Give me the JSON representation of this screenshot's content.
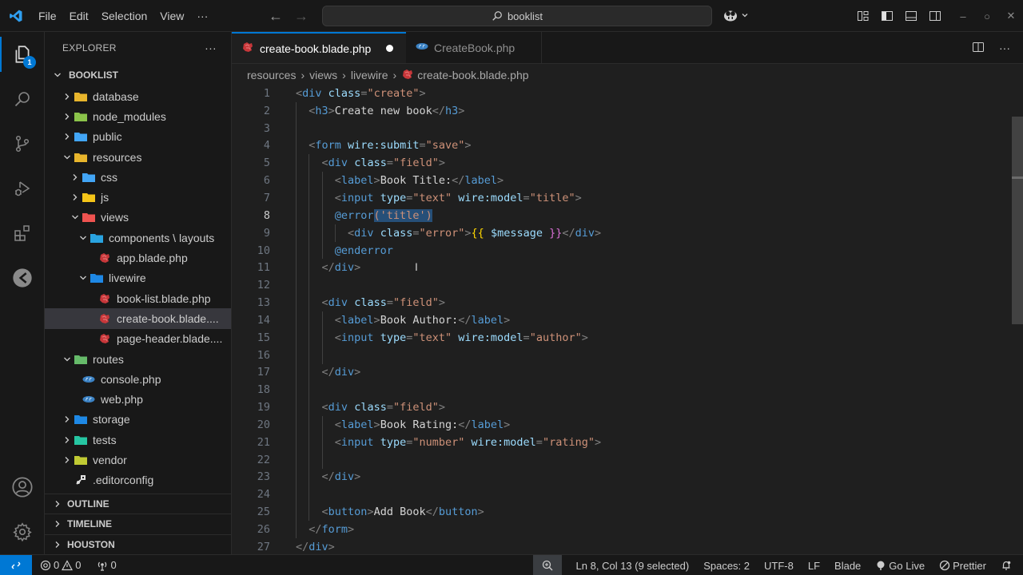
{
  "titlebar": {
    "menu": [
      "File",
      "Edit",
      "Selection",
      "View",
      "···"
    ],
    "search_text": "booklist",
    "window_controls": [
      "minimize",
      "restore",
      "close"
    ]
  },
  "activitybar": {
    "items": [
      {
        "name": "explorer",
        "badge": "1"
      },
      {
        "name": "search"
      },
      {
        "name": "source-control"
      },
      {
        "name": "run-and-debug"
      },
      {
        "name": "extensions"
      },
      {
        "name": "remote-explorer"
      }
    ],
    "bottom": [
      "accounts",
      "manage"
    ]
  },
  "sidebar": {
    "title": "EXPLORER",
    "more": "···",
    "root": "BOOKLIST",
    "tree": [
      {
        "label": "database",
        "depth": 1,
        "type": "folder",
        "expanded": false,
        "color": "#e8b52c"
      },
      {
        "label": "node_modules",
        "depth": 1,
        "type": "folder",
        "expanded": false,
        "color": "#8bc34a"
      },
      {
        "label": "public",
        "depth": 1,
        "type": "folder",
        "expanded": false,
        "color": "#42a5f5"
      },
      {
        "label": "resources",
        "depth": 1,
        "type": "folder",
        "expanded": true,
        "color": "#e8b52c"
      },
      {
        "label": "css",
        "depth": 2,
        "type": "folder",
        "expanded": false,
        "color": "#42a5f5"
      },
      {
        "label": "js",
        "depth": 2,
        "type": "folder",
        "expanded": false,
        "color": "#f5c518"
      },
      {
        "label": "views",
        "depth": 2,
        "type": "folder",
        "expanded": true,
        "color": "#ef5350"
      },
      {
        "label": "components \\ layouts",
        "depth": 3,
        "type": "folder",
        "expanded": true,
        "color": "#29a3e0"
      },
      {
        "label": "app.blade.php",
        "depth": 4,
        "type": "blade"
      },
      {
        "label": "livewire",
        "depth": 3,
        "type": "folder",
        "expanded": true,
        "color": "#1e88e5"
      },
      {
        "label": "book-list.blade.php",
        "depth": 4,
        "type": "blade"
      },
      {
        "label": "create-book.blade....",
        "depth": 4,
        "type": "blade",
        "selected": true
      },
      {
        "label": "page-header.blade....",
        "depth": 4,
        "type": "blade"
      },
      {
        "label": "routes",
        "depth": 1,
        "type": "folder",
        "expanded": true,
        "color": "#66bb6a"
      },
      {
        "label": "console.php",
        "depth": 2,
        "type": "php"
      },
      {
        "label": "web.php",
        "depth": 2,
        "type": "php"
      },
      {
        "label": "storage",
        "depth": 1,
        "type": "folder",
        "expanded": false,
        "color": "#1e88e5"
      },
      {
        "label": "tests",
        "depth": 1,
        "type": "folder",
        "expanded": false,
        "color": "#26c6a2"
      },
      {
        "label": "vendor",
        "depth": 1,
        "type": "folder",
        "expanded": false,
        "color": "#c0ca33"
      },
      {
        "label": ".editorconfig",
        "depth": 1,
        "type": "config"
      }
    ],
    "sections": [
      "OUTLINE",
      "TIMELINE",
      "HOUSTON"
    ]
  },
  "editor": {
    "tabs": [
      {
        "label": "create-book.blade.php",
        "active": true,
        "dirty": true,
        "type": "blade"
      },
      {
        "label": "CreateBook.php",
        "active": false,
        "type": "php"
      }
    ],
    "breadcrumb": [
      "resources",
      "views",
      "livewire",
      "create-book.blade.php"
    ],
    "current_line": 8,
    "lines": [
      {
        "n": "1",
        "indent": 0,
        "tokens": [
          [
            "br",
            "<"
          ],
          [
            "tag",
            "div"
          ],
          [
            "txt",
            " "
          ],
          [
            "attr",
            "class"
          ],
          [
            "br",
            "="
          ],
          [
            "str",
            "\"create\""
          ],
          [
            "br",
            ">"
          ]
        ]
      },
      {
        "n": "2",
        "indent": 1,
        "tokens": [
          [
            "br",
            "<"
          ],
          [
            "tag",
            "h3"
          ],
          [
            "br",
            ">"
          ],
          [
            "txt",
            "Create new book"
          ],
          [
            "br",
            "</"
          ],
          [
            "tag",
            "h3"
          ],
          [
            "br",
            ">"
          ]
        ]
      },
      {
        "n": "3",
        "indent": 1,
        "tokens": []
      },
      {
        "n": "4",
        "indent": 1,
        "tokens": [
          [
            "br",
            "<"
          ],
          [
            "tag",
            "form"
          ],
          [
            "txt",
            " "
          ],
          [
            "attr",
            "wire:submit"
          ],
          [
            "br",
            "="
          ],
          [
            "str",
            "\"save\""
          ],
          [
            "br",
            ">"
          ]
        ]
      },
      {
        "n": "5",
        "indent": 2,
        "tokens": [
          [
            "br",
            "<"
          ],
          [
            "tag",
            "div"
          ],
          [
            "txt",
            " "
          ],
          [
            "attr",
            "class"
          ],
          [
            "br",
            "="
          ],
          [
            "str",
            "\"field\""
          ],
          [
            "br",
            ">"
          ]
        ]
      },
      {
        "n": "6",
        "indent": 3,
        "tokens": [
          [
            "br",
            "<"
          ],
          [
            "tag",
            "label"
          ],
          [
            "br",
            ">"
          ],
          [
            "txt",
            "Book Title:"
          ],
          [
            "br",
            "</"
          ],
          [
            "tag",
            "label"
          ],
          [
            "br",
            ">"
          ]
        ]
      },
      {
        "n": "7",
        "indent": 3,
        "tokens": [
          [
            "br",
            "<"
          ],
          [
            "tag",
            "input"
          ],
          [
            "txt",
            " "
          ],
          [
            "attr",
            "type"
          ],
          [
            "br",
            "="
          ],
          [
            "str",
            "\"text\""
          ],
          [
            "txt",
            " "
          ],
          [
            "attr",
            "wire:model"
          ],
          [
            "br",
            "="
          ],
          [
            "str",
            "\"title\""
          ],
          [
            "br",
            ">"
          ]
        ]
      },
      {
        "n": "8",
        "indent": 3,
        "tokens": [
          [
            "dir",
            "@error"
          ],
          [
            "sel",
            "('title')"
          ]
        ]
      },
      {
        "n": "9",
        "indent": 4,
        "tokens": [
          [
            "br",
            "<"
          ],
          [
            "tag",
            "div"
          ],
          [
            "txt",
            " "
          ],
          [
            "attr",
            "class"
          ],
          [
            "br",
            "="
          ],
          [
            "str",
            "\"error\""
          ],
          [
            "br",
            ">"
          ],
          [
            "y",
            "{{"
          ],
          [
            "txt",
            " "
          ],
          [
            "var",
            "$message"
          ],
          [
            "txt",
            " "
          ],
          [
            "p",
            "}}"
          ],
          [
            "br",
            "</"
          ],
          [
            "tag",
            "div"
          ],
          [
            "br",
            ">"
          ]
        ]
      },
      {
        "n": "10",
        "indent": 3,
        "tokens": [
          [
            "dir",
            "@enderror"
          ]
        ]
      },
      {
        "n": "11",
        "indent": 2,
        "tokens": [
          [
            "br",
            "</"
          ],
          [
            "tag",
            "div"
          ],
          [
            "br",
            ">"
          ]
        ]
      },
      {
        "n": "12",
        "indent": 2,
        "tokens": []
      },
      {
        "n": "13",
        "indent": 2,
        "tokens": [
          [
            "br",
            "<"
          ],
          [
            "tag",
            "div"
          ],
          [
            "txt",
            " "
          ],
          [
            "attr",
            "class"
          ],
          [
            "br",
            "="
          ],
          [
            "str",
            "\"field\""
          ],
          [
            "br",
            ">"
          ]
        ]
      },
      {
        "n": "14",
        "indent": 3,
        "tokens": [
          [
            "br",
            "<"
          ],
          [
            "tag",
            "label"
          ],
          [
            "br",
            ">"
          ],
          [
            "txt",
            "Book Author:"
          ],
          [
            "br",
            "</"
          ],
          [
            "tag",
            "label"
          ],
          [
            "br",
            ">"
          ]
        ]
      },
      {
        "n": "15",
        "indent": 3,
        "tokens": [
          [
            "br",
            "<"
          ],
          [
            "tag",
            "input"
          ],
          [
            "txt",
            " "
          ],
          [
            "attr",
            "type"
          ],
          [
            "br",
            "="
          ],
          [
            "str",
            "\"text\""
          ],
          [
            "txt",
            " "
          ],
          [
            "attr",
            "wire:model"
          ],
          [
            "br",
            "="
          ],
          [
            "str",
            "\"author\""
          ],
          [
            "br",
            ">"
          ]
        ]
      },
      {
        "n": "16",
        "indent": 3,
        "tokens": []
      },
      {
        "n": "17",
        "indent": 2,
        "tokens": [
          [
            "br",
            "</"
          ],
          [
            "tag",
            "div"
          ],
          [
            "br",
            ">"
          ]
        ]
      },
      {
        "n": "18",
        "indent": 2,
        "tokens": []
      },
      {
        "n": "19",
        "indent": 2,
        "tokens": [
          [
            "br",
            "<"
          ],
          [
            "tag",
            "div"
          ],
          [
            "txt",
            " "
          ],
          [
            "attr",
            "class"
          ],
          [
            "br",
            "="
          ],
          [
            "str",
            "\"field\""
          ],
          [
            "br",
            ">"
          ]
        ]
      },
      {
        "n": "20",
        "indent": 3,
        "tokens": [
          [
            "br",
            "<"
          ],
          [
            "tag",
            "label"
          ],
          [
            "br",
            ">"
          ],
          [
            "txt",
            "Book Rating:"
          ],
          [
            "br",
            "</"
          ],
          [
            "tag",
            "label"
          ],
          [
            "br",
            ">"
          ]
        ]
      },
      {
        "n": "21",
        "indent": 3,
        "tokens": [
          [
            "br",
            "<"
          ],
          [
            "tag",
            "input"
          ],
          [
            "txt",
            " "
          ],
          [
            "attr",
            "type"
          ],
          [
            "br",
            "="
          ],
          [
            "str",
            "\"number\""
          ],
          [
            "txt",
            " "
          ],
          [
            "attr",
            "wire:model"
          ],
          [
            "br",
            "="
          ],
          [
            "str",
            "\"rating\""
          ],
          [
            "br",
            ">"
          ]
        ]
      },
      {
        "n": "22",
        "indent": 3,
        "tokens": []
      },
      {
        "n": "23",
        "indent": 2,
        "tokens": [
          [
            "br",
            "</"
          ],
          [
            "tag",
            "div"
          ],
          [
            "br",
            ">"
          ]
        ]
      },
      {
        "n": "24",
        "indent": 2,
        "tokens": []
      },
      {
        "n": "25",
        "indent": 2,
        "tokens": [
          [
            "br",
            "<"
          ],
          [
            "tag",
            "button"
          ],
          [
            "br",
            ">"
          ],
          [
            "txt",
            "Add Book"
          ],
          [
            "br",
            "</"
          ],
          [
            "tag",
            "button"
          ],
          [
            "br",
            ">"
          ]
        ]
      },
      {
        "n": "26",
        "indent": 1,
        "tokens": [
          [
            "br",
            "</"
          ],
          [
            "tag",
            "form"
          ],
          [
            "br",
            ">"
          ]
        ]
      },
      {
        "n": "27",
        "indent": 0,
        "tokens": [
          [
            "br",
            "</"
          ],
          [
            "tag",
            "div"
          ],
          [
            "br",
            ">"
          ]
        ]
      }
    ]
  },
  "statusbar": {
    "errors": "0",
    "warnings": "0",
    "ports": "0",
    "position": "Ln 8, Col 13 (9 selected)",
    "spaces": "Spaces: 2",
    "encoding": "UTF-8",
    "eol": "LF",
    "language": "Blade",
    "golive": "Go Live",
    "prettier": "Prettier"
  }
}
